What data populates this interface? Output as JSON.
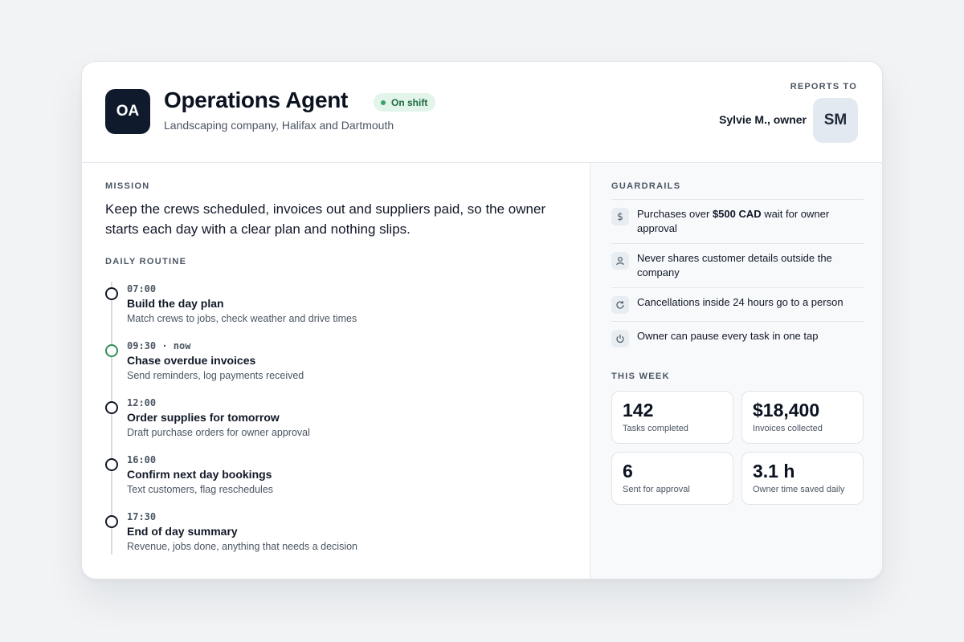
{
  "agent": {
    "initials": "OA",
    "title": "Operations Agent",
    "status": "On shift",
    "subtitle": "Landscaping company, Halifax and Dartmouth"
  },
  "reports_to": {
    "label": "REPORTS TO",
    "name": "Sylvie M., owner",
    "initials": "SM"
  },
  "mission": {
    "label": "MISSION",
    "text": "Keep the crews scheduled, invoices out and suppliers paid, so the owner starts each day with a clear plan and nothing slips."
  },
  "routine": {
    "label": "DAILY ROUTINE",
    "items": [
      {
        "time": "07:00",
        "title": "Build the day plan",
        "desc": "Match crews to jobs, check weather and drive times",
        "active": false
      },
      {
        "time": "09:30 · now",
        "title": "Chase overdue invoices",
        "desc": "Send reminders, log payments received",
        "active": true
      },
      {
        "time": "12:00",
        "title": "Order supplies for tomorrow",
        "desc": "Draft purchase orders for owner approval",
        "active": false
      },
      {
        "time": "16:00",
        "title": "Confirm next day bookings",
        "desc": "Text customers, flag reschedules",
        "active": false
      },
      {
        "time": "17:30",
        "title": "End of day summary",
        "desc": "Revenue, jobs done, anything that needs a decision",
        "active": false
      }
    ]
  },
  "guardrails": {
    "label": "GUARDRAILS",
    "items": [
      {
        "icon": "dollar-icon",
        "pre": "Purchases over ",
        "bold": "$500 CAD",
        "post": " wait for owner approval"
      },
      {
        "icon": "person-icon",
        "pre": "Never shares customer details outside the company",
        "bold": "",
        "post": ""
      },
      {
        "icon": "refresh-icon",
        "pre": "Cancellations inside 24 hours go to a person",
        "bold": "",
        "post": ""
      },
      {
        "icon": "power-icon",
        "pre": "Owner can pause every task in one tap",
        "bold": "",
        "post": ""
      }
    ]
  },
  "this_week": {
    "label": "THIS WEEK",
    "stats": [
      {
        "value": "142",
        "label": "Tasks completed"
      },
      {
        "value": "$18,400",
        "label": "Invoices collected"
      },
      {
        "value": "6",
        "label": "Sent for approval"
      },
      {
        "value": "3.1 h",
        "label": "Owner time saved daily"
      }
    ]
  },
  "colors": {
    "accent_dark": "#0f1b2d",
    "status_green": "#2f8f57",
    "status_bg": "#e3f4ea"
  }
}
